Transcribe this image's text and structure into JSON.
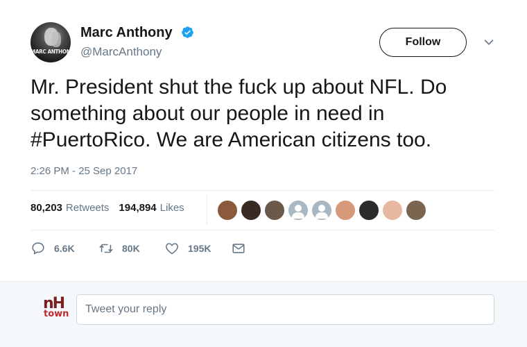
{
  "author": {
    "name": "Marc Anthony",
    "handle": "@MarcAnthony",
    "verified": true,
    "avatar_watermark": "MARC ANTHONY"
  },
  "follow_button": {
    "label": "Follow"
  },
  "tweet": {
    "text": "Mr. President shut the fuck up about NFL. Do something about our people in need in #PuertoRico. We are American citizens too.",
    "timestamp": "2:26 PM - 25 Sep 2017"
  },
  "stats": {
    "retweets_count": "80,203",
    "retweets_label": "Retweets",
    "likes_count": "194,894",
    "likes_label": "Likes"
  },
  "liker_avatars": [
    {
      "color": "#8b5a3c"
    },
    {
      "color": "#3a2a24"
    },
    {
      "color": "#6b5a4a"
    },
    {
      "color": "#aab8c2",
      "generic": true
    },
    {
      "color": "#aab8c2",
      "generic": true
    },
    {
      "color": "#d69a7a"
    },
    {
      "color": "#2b2b2b"
    },
    {
      "color": "#e6b8a2"
    },
    {
      "color": "#7a6650"
    }
  ],
  "actions": {
    "reply_count": "6.6K",
    "retweet_count": "80K",
    "like_count": "195K"
  },
  "reply": {
    "placeholder": "Tweet your reply",
    "logo_top": "nH",
    "logo_bottom": "town"
  },
  "colors": {
    "verified_blue": "#1da1f2",
    "secondary_text": "#657786",
    "primary_text": "#14171a",
    "logo_dark_red": "#7a1f22",
    "logo_red": "#c0272d"
  }
}
